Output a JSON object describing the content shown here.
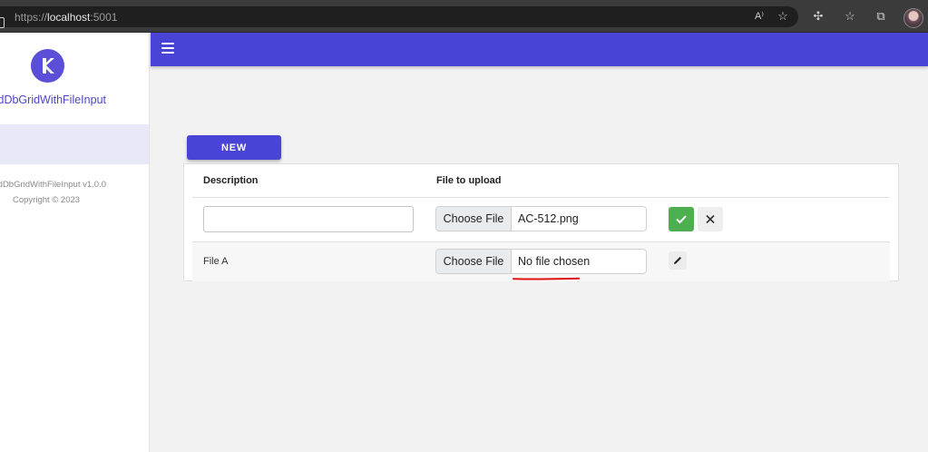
{
  "browser": {
    "url_scheme": "https://",
    "url_host": "localhost",
    "url_port": ":5001",
    "icons": [
      "read-aloud-icon",
      "favorite-add-icon",
      "extensions-icon",
      "favorites-icon",
      "collections-icon",
      "profile-avatar"
    ]
  },
  "sidebar": {
    "app_title": "dDbGridWithFileInput",
    "version": "dDbGridWithFileInput v1.0.0",
    "copyright": "Copyright © 2023"
  },
  "toolbar": {
    "new_label": "NEW"
  },
  "grid": {
    "columns": [
      "Description",
      "File to upload"
    ],
    "edit_row": {
      "description": "",
      "file_button": "Choose File",
      "file_name": "AC-512.png"
    },
    "row": {
      "description": "File A",
      "file_button": "Choose File",
      "file_name": "No file chosen"
    }
  },
  "colors": {
    "accent": "#4a44d6",
    "confirm": "#4caf50",
    "annotation": "#e01010"
  }
}
